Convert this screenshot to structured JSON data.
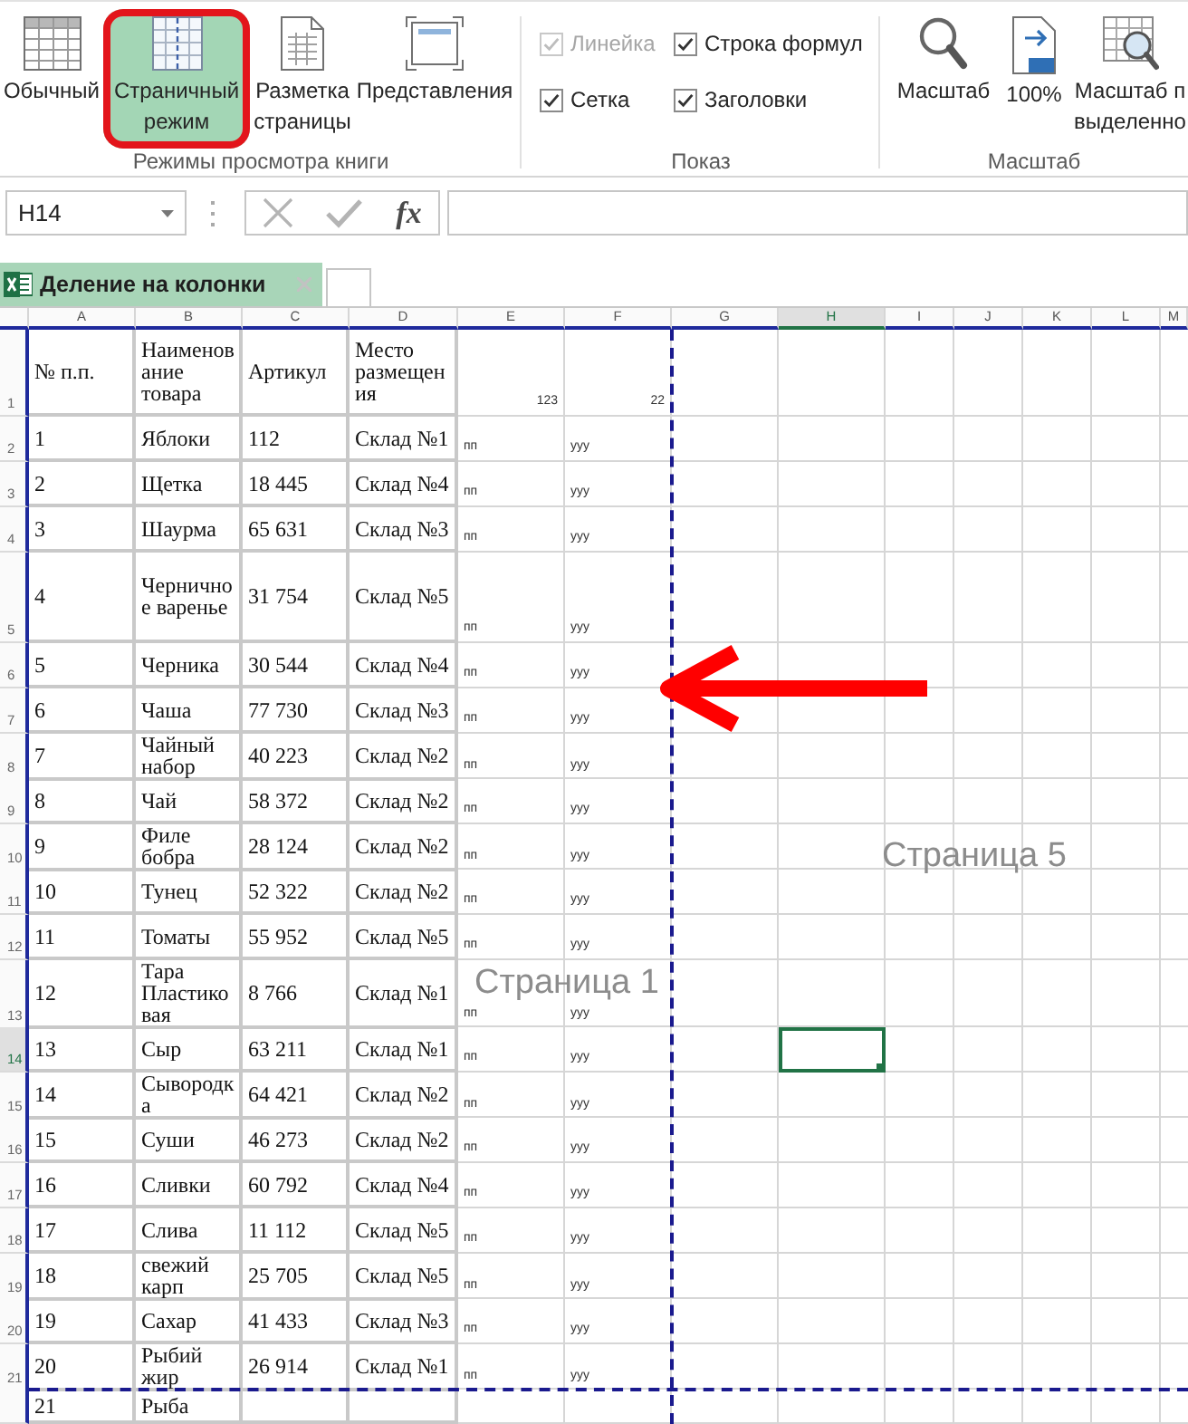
{
  "ribbon": {
    "groups": [
      {
        "kind": "buttons",
        "label": "Режимы просмотра книги",
        "buttons": [
          {
            "label": "Обычный",
            "selected": false,
            "highlighted": false
          },
          {
            "label": "Страничный\nрежим",
            "selected": true,
            "highlighted": true
          },
          {
            "label": "Разметка\nстраницы",
            "selected": false,
            "highlighted": false
          },
          {
            "label": "Представления",
            "selected": false,
            "highlighted": false
          }
        ]
      },
      {
        "kind": "checkboxes",
        "label": "Показ",
        "items": [
          {
            "label": "Линейка",
            "checked": true,
            "disabled": true
          },
          {
            "label": "Строка формул",
            "checked": true,
            "disabled": false
          },
          {
            "label": "Сетка",
            "checked": true,
            "disabled": false
          },
          {
            "label": "Заголовки",
            "checked": true,
            "disabled": false
          }
        ]
      },
      {
        "kind": "buttons",
        "label": "Масштаб",
        "buttons": [
          {
            "label": "Масштаб"
          },
          {
            "label": "100%"
          },
          {
            "label": "Масштаб п\nвыделенно"
          }
        ]
      }
    ]
  },
  "formula_bar": {
    "name_box": "H14",
    "controls": [
      {
        "kind": "cancel",
        "disabled": true
      },
      {
        "kind": "enter",
        "disabled": true
      },
      {
        "kind": "function",
        "label": "fx",
        "disabled": false
      }
    ]
  },
  "sheet_tabs": [
    {
      "label": "Деление на колонки",
      "selected": true
    }
  ],
  "sheet": {
    "columns": [
      {
        "label": "A",
        "selected": false,
        "page_break_after": false
      },
      {
        "label": "B",
        "selected": false,
        "page_break_after": false
      },
      {
        "label": "C",
        "selected": false,
        "page_break_after": false
      },
      {
        "label": "D",
        "selected": false,
        "page_break_after": false
      },
      {
        "label": "E",
        "selected": false,
        "page_break_after": false
      },
      {
        "label": "F",
        "selected": false,
        "page_break_after": true
      },
      {
        "label": "G",
        "selected": false,
        "page_break_after": false
      },
      {
        "label": "H",
        "selected": true,
        "page_break_after": false
      },
      {
        "label": "I",
        "selected": false,
        "page_break_after": false
      },
      {
        "label": "J",
        "selected": false,
        "page_break_after": false
      },
      {
        "label": "K",
        "selected": false,
        "page_break_after": false
      },
      {
        "label": "L",
        "selected": false,
        "page_break_after": false
      },
      {
        "label": "M",
        "selected": false,
        "page_break_after": false
      }
    ],
    "rows": [
      {
        "label": "1",
        "kind": "header",
        "selected": false,
        "page_break_after": false,
        "cells": [
          "№ п.п.",
          "Наименов\nание\nтовара",
          "Артикул",
          "Место\nразмещен\nия",
          "123",
          "22"
        ]
      },
      {
        "label": "2",
        "kind": "data",
        "selected": false,
        "page_break_after": false,
        "cells": [
          "1",
          "Яблоки",
          "112",
          "Склад №1",
          "пп",
          "yyy"
        ]
      },
      {
        "label": "3",
        "kind": "data",
        "selected": false,
        "page_break_after": false,
        "cells": [
          "2",
          "Щетка",
          "18 445",
          "Склад №4",
          "пп",
          "yyy"
        ]
      },
      {
        "label": "4",
        "kind": "data",
        "selected": false,
        "page_break_after": false,
        "cells": [
          "3",
          "Шаурма",
          "65 631",
          "Склад №3",
          "пп",
          "yyy"
        ]
      },
      {
        "label": "5",
        "kind": "data",
        "selected": false,
        "page_break_after": false,
        "cells": [
          "4",
          "Чернично\nе варенье",
          "31 754",
          "Склад №5",
          "пп",
          "yyy"
        ]
      },
      {
        "label": "6",
        "kind": "data",
        "selected": false,
        "page_break_after": false,
        "cells": [
          "5",
          "Черника",
          "30 544",
          "Склад №4",
          "пп",
          "yyy"
        ]
      },
      {
        "label": "7",
        "kind": "data",
        "selected": false,
        "page_break_after": false,
        "cells": [
          "6",
          "Чаша",
          "77 730",
          "Склад №3",
          "пп",
          "yyy"
        ]
      },
      {
        "label": "8",
        "kind": "data",
        "selected": false,
        "page_break_after": false,
        "cells": [
          "7",
          "Чайный\nнабор",
          "40 223",
          "Склад №2",
          "пп",
          "yyy"
        ]
      },
      {
        "label": "9",
        "kind": "data",
        "selected": false,
        "page_break_after": false,
        "cells": [
          "8",
          "Чай",
          "58 372",
          "Склад №2",
          "пп",
          "yyy"
        ]
      },
      {
        "label": "10",
        "kind": "data",
        "selected": false,
        "page_break_after": false,
        "cells": [
          "9",
          "Филе\nбобра",
          "28 124",
          "Склад №2",
          "пп",
          "yyy"
        ]
      },
      {
        "label": "11",
        "kind": "data",
        "selected": false,
        "page_break_after": false,
        "cells": [
          "10",
          "Тунец",
          "52 322",
          "Склад №2",
          "пп",
          "yyy"
        ]
      },
      {
        "label": "12",
        "kind": "data",
        "selected": false,
        "page_break_after": false,
        "cells": [
          "11",
          "Томаты",
          "55 952",
          "Склад №5",
          "пп",
          "yyy"
        ]
      },
      {
        "label": "13",
        "kind": "data",
        "selected": false,
        "page_break_after": false,
        "cells": [
          "12",
          "Тара\nПластико\nвая",
          "8 766",
          "Склад №1",
          "пп",
          "yyy"
        ]
      },
      {
        "label": "14",
        "kind": "data",
        "selected": true,
        "page_break_after": false,
        "cells": [
          "13",
          "Сыр",
          "63 211",
          "Склад №1",
          "пп",
          "yyy"
        ]
      },
      {
        "label": "15",
        "kind": "data",
        "selected": false,
        "page_break_after": false,
        "cells": [
          "14",
          "Сывородк\nа",
          "64 421",
          "Склад №2",
          "пп",
          "yyy"
        ]
      },
      {
        "label": "16",
        "kind": "data",
        "selected": false,
        "page_break_after": false,
        "cells": [
          "15",
          "Суши",
          "46 273",
          "Склад №2",
          "пп",
          "yyy"
        ]
      },
      {
        "label": "17",
        "kind": "data",
        "selected": false,
        "page_break_after": false,
        "cells": [
          "16",
          "Сливки",
          "60 792",
          "Склад №4",
          "пп",
          "yyy"
        ]
      },
      {
        "label": "18",
        "kind": "data",
        "selected": false,
        "page_break_after": false,
        "cells": [
          "17",
          "Слива",
          "11 112",
          "Склад №5",
          "пп",
          "yyy"
        ]
      },
      {
        "label": "19",
        "kind": "data",
        "selected": false,
        "page_break_after": false,
        "cells": [
          "18",
          "свежий\nкарп",
          "25 705",
          "Склад №5",
          "пп",
          "yyy"
        ]
      },
      {
        "label": "20",
        "kind": "data",
        "selected": false,
        "page_break_after": false,
        "cells": [
          "19",
          "Сахар",
          "41 433",
          "Склад №3",
          "пп",
          "yyy"
        ]
      },
      {
        "label": "21",
        "kind": "data",
        "selected": false,
        "page_break_after": true,
        "cells": [
          "20",
          "Рыбий\nжир",
          "26 914",
          "Склад №1",
          "пп",
          "yyy"
        ]
      },
      {
        "kind": "data",
        "selected": false,
        "cells": [
          "21",
          "Рыба"
        ]
      }
    ],
    "page_labels": [
      "Страница 1",
      "Страница 5"
    ]
  }
}
